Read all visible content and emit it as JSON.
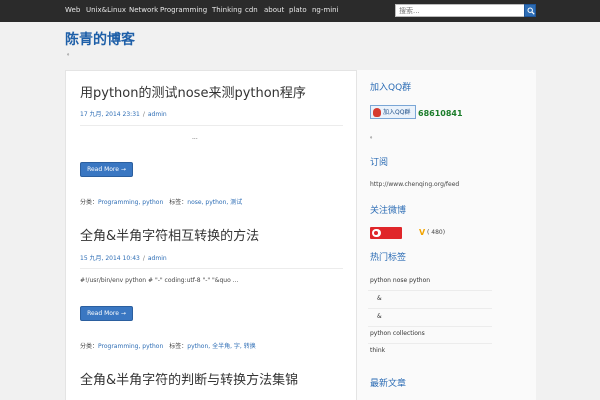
{
  "topnav": {
    "links": [
      "Web",
      "Unix&Linux",
      "Network",
      "Programming",
      "Thinking",
      "cdn",
      "about",
      "plato",
      "ng-mini"
    ]
  },
  "search": {
    "placeholder": "搜索..."
  },
  "site": {
    "title": "陈青的博客",
    "description": "。"
  },
  "posts": [
    {
      "title": "用python的测试nose来测python程序",
      "date": "17 九月, 2014 23:31",
      "author": "admin",
      "excerpt": "...",
      "read_more": "Read More →",
      "category_label": "分类：",
      "categories": "Programming, python",
      "tags_label": "标签：",
      "tags": "nose, python, 测试"
    },
    {
      "title": "全角&半角字符相互转换的方法",
      "date": "15 九月, 2014 10:43",
      "author": "admin",
      "excerpt": "#!/usr/bin/env python # \"-\" coding:utf-8 \"-\" \"&quo ...",
      "read_more": "Read More →",
      "category_label": "分类：",
      "categories": "Programming, python",
      "tags_label": "标签：",
      "tags": "python, 全半角, 字, 转换"
    },
    {
      "title": "全角&半角字符的判断与转换方法集锦"
    }
  ],
  "sidebar": {
    "qq_title": "加入QQ群",
    "qq_badge": "加入QQ群",
    "qq_number": "68610841",
    "qq_note": "。",
    "rss_title": "订阅",
    "rss_url": "http://www.chenqing.org/feed",
    "weibo_title": "关注微博",
    "weibo_v": "V",
    "weibo_count": "( 480)",
    "tags_title": "热门标签",
    "tag_rows": [
      "python   nose   python",
      "&",
      "&",
      "python   collections",
      "think"
    ],
    "last_title": "最新文章"
  }
}
